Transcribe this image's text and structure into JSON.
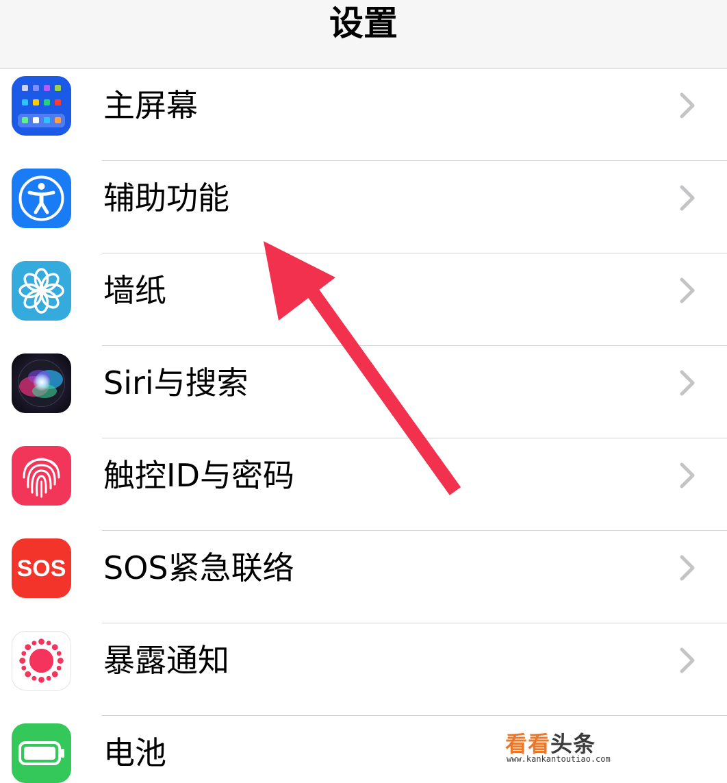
{
  "header": {
    "title": "设置"
  },
  "settings": {
    "items": [
      {
        "label": "主屏幕",
        "icon": "home-screen-icon",
        "color": "#1a5ae6"
      },
      {
        "label": "辅助功能",
        "icon": "accessibility-icon",
        "color": "#1a7cf5"
      },
      {
        "label": "墙纸",
        "icon": "wallpaper-flower-icon",
        "color": "#35aadc"
      },
      {
        "label": "Siri与搜索",
        "icon": "siri-icon",
        "color": "#1c1c2e"
      },
      {
        "label": "触控ID与密码",
        "icon": "fingerprint-icon",
        "color": "#f2365a"
      },
      {
        "label": "SOS紧急联络",
        "icon": "sos-icon",
        "color": "#f2342b"
      },
      {
        "label": "暴露通知",
        "icon": "exposure-notification-icon",
        "color": "#ffffff"
      },
      {
        "label": "电池",
        "icon": "battery-icon",
        "color": "#34c759"
      }
    ]
  },
  "icons": {
    "sos_text": "SOS"
  },
  "annotation": {
    "arrow_color": "#f2314e"
  },
  "watermark": {
    "brand_a": "看看",
    "brand_b": "头条",
    "url": "www.kankantoutiao.com"
  }
}
